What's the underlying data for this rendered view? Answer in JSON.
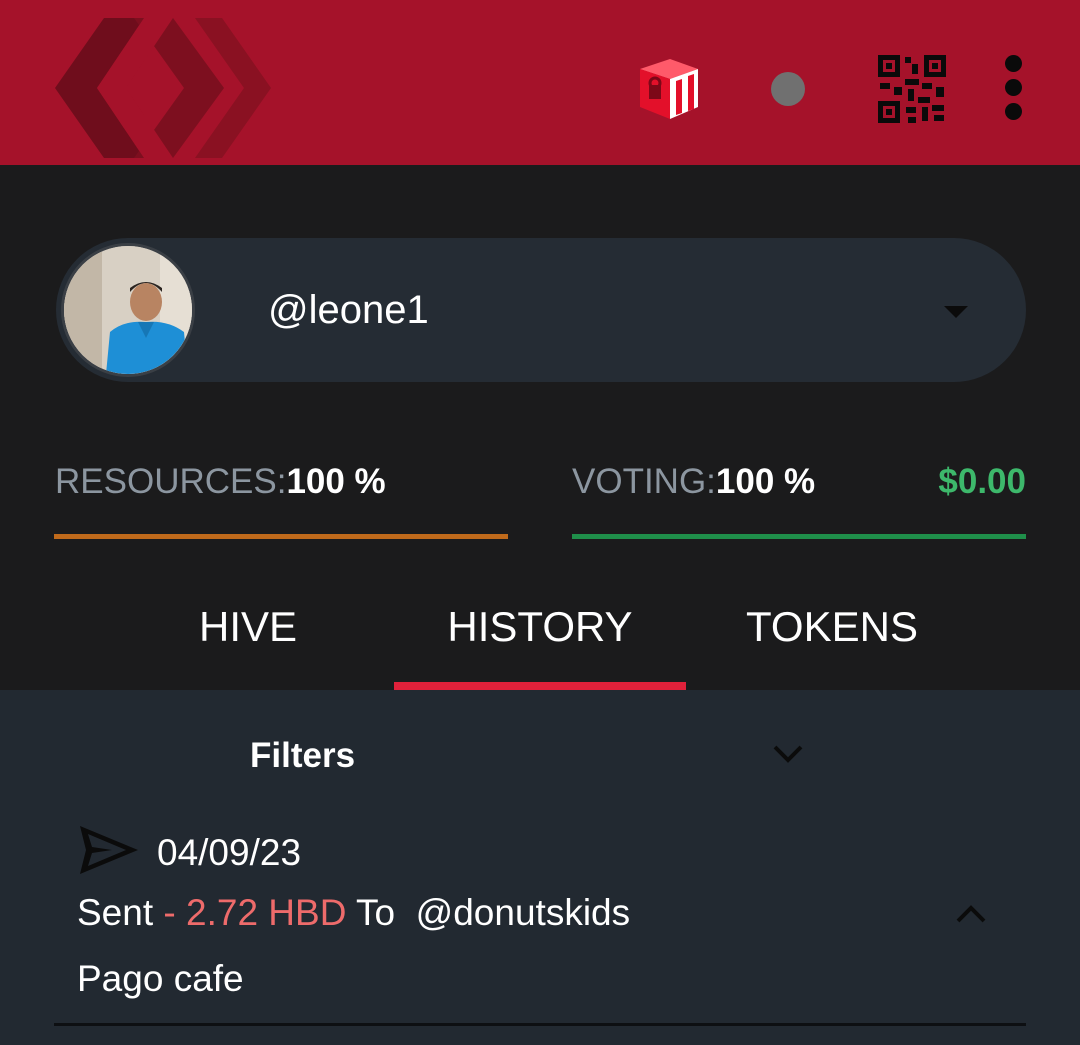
{
  "header": {
    "logo": "hive-logo-icon",
    "keychain_icon": "keychain-icon",
    "status_icon": "status-dot",
    "qr_icon": "qr-code-icon",
    "menu_icon": "more-vertical-icon"
  },
  "account": {
    "username": "@leone1"
  },
  "stats": {
    "resources_label": "RESOURCES:",
    "resources_value": "100 %",
    "voting_label": "VOTING:",
    "voting_value": "100 %",
    "vote_value": "$0.00"
  },
  "tabs": [
    {
      "label": "HIVE"
    },
    {
      "label": "HISTORY"
    },
    {
      "label": "TOKENS"
    }
  ],
  "history": {
    "filters_label": "Filters",
    "transactions": [
      {
        "date": "04/09/23",
        "prefix": "Sent ",
        "amount": "- 2.72 HBD",
        "to_text": " To  @donutskids",
        "memo": "Pago cafe"
      }
    ]
  },
  "colors": {
    "header_bg": "#a5122a",
    "accent_red": "#e0213a",
    "resources_bar": "#c06a1b",
    "voting_bar": "#1f8f4a",
    "vote_value": "#3db86b",
    "sent_amount": "#ee6b6b"
  }
}
